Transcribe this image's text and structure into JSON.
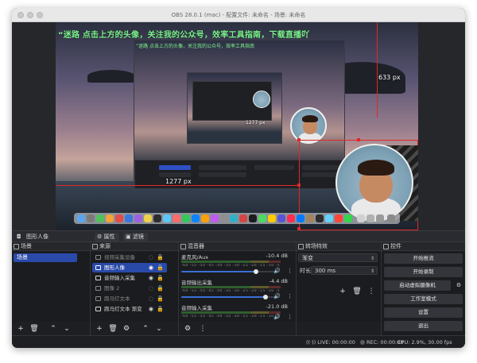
{
  "window": {
    "title": "OBS 28.0.1 (mac) - 配置文件: 未命名 - 场景: 未命名"
  },
  "preview": {
    "overlay_text": "“迷路    点击上方的头像，关注我的公众号，效率工具指南，下载直播吖",
    "nested_overlay_text": "“迷路    点击上方的头像，关注我的公众号，效率工具指南",
    "guide_width_label": "1277 px",
    "guide_height_label": "633 px",
    "nested_width_label": "1277 px"
  },
  "context_bar": {
    "source_name": "图形人像",
    "properties_label": "属性",
    "filters_label": "滤镜"
  },
  "scenes": {
    "title": "场景",
    "items": [
      "场景"
    ]
  },
  "sources": {
    "title": "来源",
    "items": [
      {
        "label": "视频采集设备",
        "visible": false
      },
      {
        "label": "图形人像",
        "visible": true
      },
      {
        "label": "音频输入采集",
        "visible": true
      },
      {
        "label": "图像 2",
        "visible": false
      },
      {
        "label": "跑马灯文本",
        "visible": false
      },
      {
        "label": "跑马灯文本 渐变",
        "visible": true
      }
    ]
  },
  "mixer": {
    "title": "混音器",
    "ticks": "-60 -55 -50 -45 -40 -35 -30 -25 -20 -15 -10 -5 0",
    "channels": [
      {
        "name": "麦克风/Aux",
        "db": "-10.4 dB",
        "level": 0.8
      },
      {
        "name": "音频输出采集",
        "db": "-4.4 dB",
        "level": 0.9
      },
      {
        "name": "音频输入采集",
        "db": "-21.0 dB",
        "level": 0.55
      }
    ]
  },
  "transitions": {
    "title": "转场特效",
    "selected": "渐变",
    "duration_label": "时长",
    "duration_value": "300 ms"
  },
  "controls": {
    "title": "控件",
    "start_stream": "开始推流",
    "start_record": "开始录制",
    "virtual_cam": "启动虚拟摄像机",
    "studio_mode": "工作室模式",
    "settings": "设置",
    "exit": "退出"
  },
  "status": {
    "live": "LIVE: 00:00:00",
    "rec": "REC: 00:00:00",
    "cpu": "CPU: 2.9%, 30.00 fps"
  }
}
